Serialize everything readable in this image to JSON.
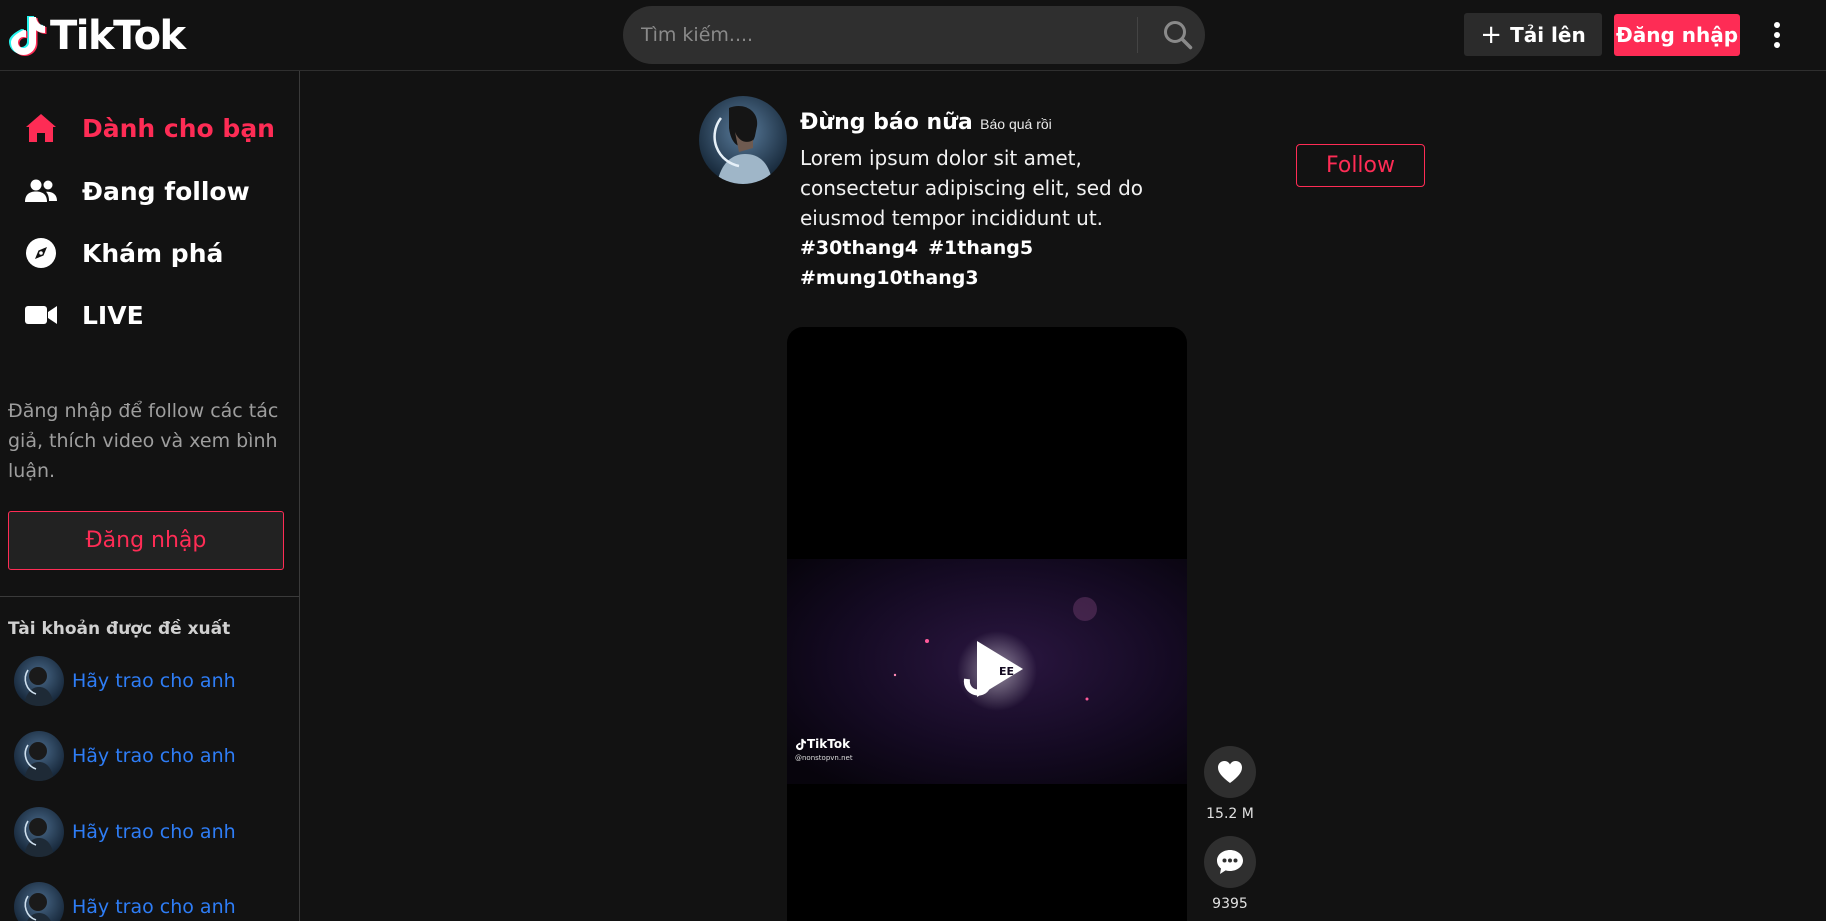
{
  "header": {
    "logo_text": "TikTok",
    "search_placeholder": "Tìm kiếm....",
    "upload_label": "Tải lên",
    "login_label": "Đăng nhập"
  },
  "sidebar": {
    "nav": [
      {
        "label": "Dành cho bạn",
        "icon": "home-icon",
        "active": true
      },
      {
        "label": "Đang follow",
        "icon": "users-icon",
        "active": false
      },
      {
        "label": "Khám phá",
        "icon": "compass-icon",
        "active": false
      },
      {
        "label": "LIVE",
        "icon": "video-camera-icon",
        "active": false
      }
    ],
    "login_note": "Đăng nhập để follow các tác giả, thích video và xem bình luận.",
    "login_button": "Đăng nhập",
    "suggested_title": "Tài khoản được đề xuất",
    "suggested_accounts": [
      {
        "name": "Hãy trao cho anh"
      },
      {
        "name": "Hãy trao cho anh"
      },
      {
        "name": "Hãy trao cho anh"
      },
      {
        "name": "Hãy trao cho anh"
      }
    ]
  },
  "post": {
    "author": "Đừng báo nữa",
    "nickname": "Báo quá rồi",
    "description": "Lorem ipsum dolor sit amet, consectetur adipiscing elit, sed do eiusmod tempor incididunt ut.",
    "hashtags": [
      "#30thang4",
      "#1thang5",
      "#mung10thang3"
    ],
    "follow_label": "Follow",
    "video_watermark": "TikTok",
    "video_handle": "@nonstopvn.net",
    "likes": "15.2 M",
    "comments": "9395"
  },
  "colors": {
    "accent": "#fe2c55",
    "background": "#121212",
    "link": "#2e7df6"
  }
}
